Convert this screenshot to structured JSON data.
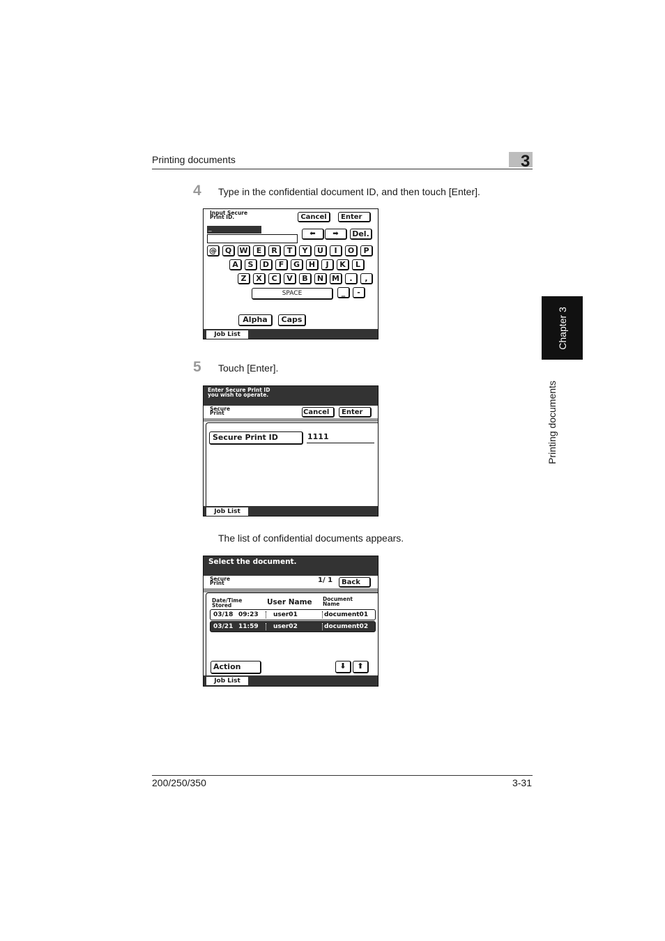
{
  "header": {
    "section": "Printing documents",
    "chapter_number": "3"
  },
  "side_tab": {
    "chapter": "Chapter 3",
    "section": "Printing documents"
  },
  "steps": [
    {
      "number": "4",
      "text": "Type in the confidential document ID, and then touch [Enter]."
    },
    {
      "number": "5",
      "text": "Touch [Enter]."
    }
  ],
  "note": "The list of confidential documents appears.",
  "screen1": {
    "title_line1": "Input Secure",
    "title_line2": "Print ID.",
    "cancel": "Cancel",
    "enter": "Enter",
    "cursor": "_",
    "left_arrow": "⬅",
    "right_arrow": "➡",
    "del": "Del.",
    "row1": [
      "@",
      "Q",
      "W",
      "E",
      "R",
      "T",
      "Y",
      "U",
      "I",
      "O",
      "P"
    ],
    "row2": [
      "A",
      "S",
      "D",
      "F",
      "G",
      "H",
      "J",
      "K",
      "L"
    ],
    "row3": [
      "Z",
      "X",
      "C",
      "V",
      "B",
      "N",
      "M",
      ".",
      ","
    ],
    "space": "SPACE",
    "underscore": "_",
    "hyphen": "-",
    "alpha": "Alpha",
    "caps": "Caps",
    "job_list": "Job List"
  },
  "screen2": {
    "message_line1": "Enter Secure Print ID",
    "message_line2": "you wish to operate.",
    "mode_line1": "Secure",
    "mode_line2": "Print",
    "cancel": "Cancel",
    "enter": "Enter",
    "field_label": "Secure Print ID",
    "field_value": "1111",
    "job_list": "Job List"
  },
  "screen3": {
    "message": "Select the document.",
    "mode_line1": "Secure",
    "mode_line2": "Print",
    "page": "1/ 1",
    "back": "Back",
    "columns": {
      "date_line1": "Date/Time",
      "date_line2": "Stored",
      "user": "User Name",
      "doc_line1": "Document",
      "doc_line2": "Name"
    },
    "rows": [
      {
        "date": "03/18",
        "time": "09:23",
        "user": "user01",
        "document": "document01",
        "selected": false
      },
      {
        "date": "03/21",
        "time": "11:59",
        "user": "user02",
        "document": "document02",
        "selected": true
      }
    ],
    "action": "Action",
    "down_arrow": "⬇",
    "up_arrow": "⬆",
    "job_list": "Job List"
  },
  "footer": {
    "model": "200/250/350",
    "page": "3-31"
  }
}
